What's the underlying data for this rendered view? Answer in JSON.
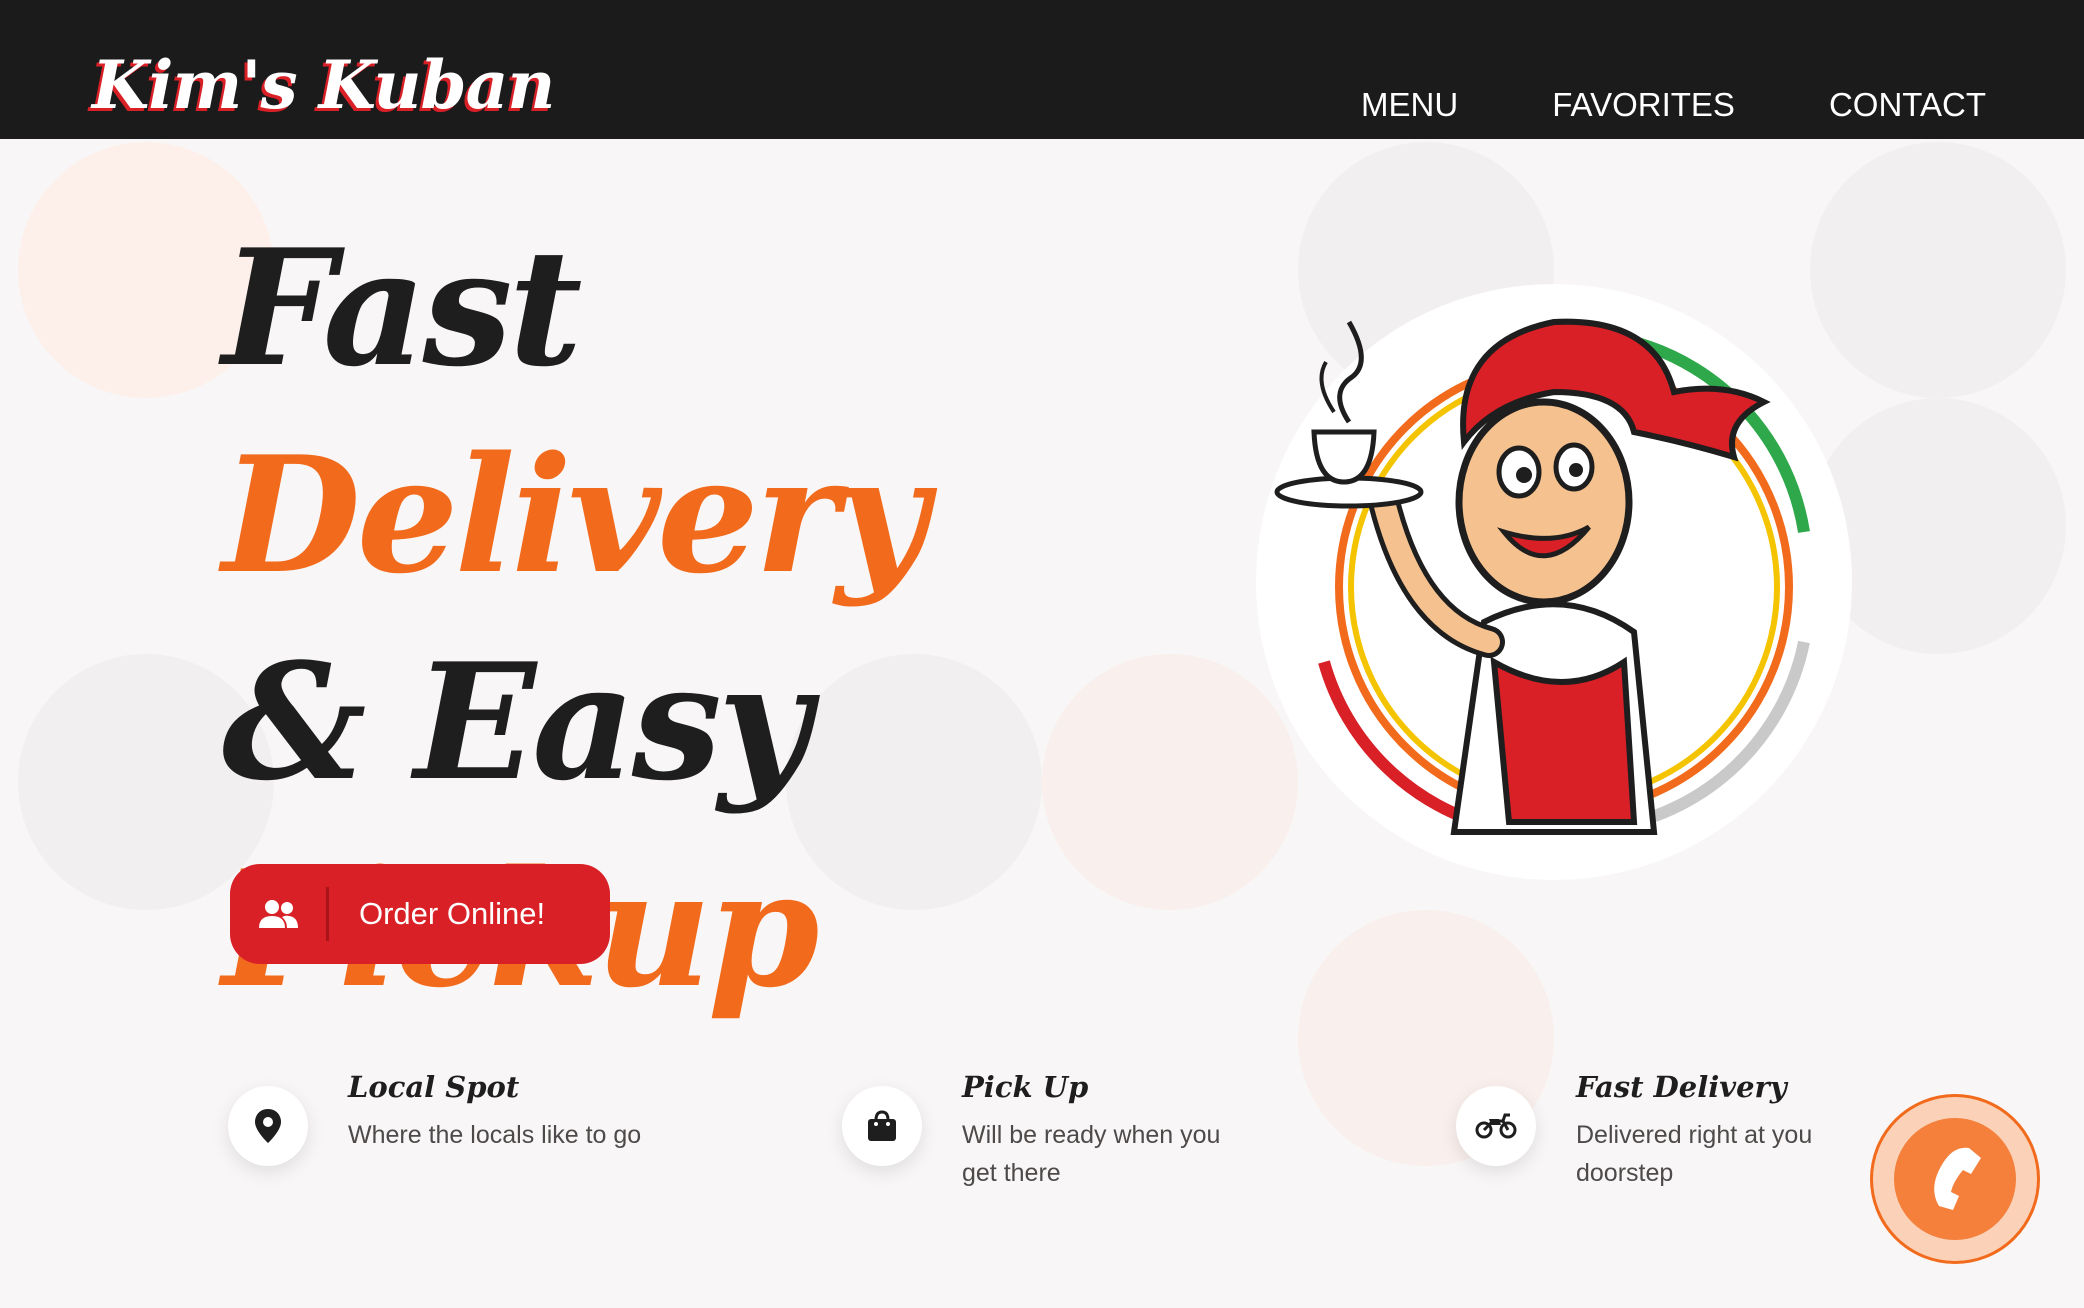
{
  "header": {
    "brand": "Kim's Kuban",
    "nav": [
      "MENU",
      "FAVORITES",
      "CONTACT"
    ]
  },
  "hero": {
    "line1_black": "Fast",
    "line1_orange": "Delivery",
    "line2": "& Easy",
    "line3": "Pickup",
    "cta_label": "Order Online!"
  },
  "features": [
    {
      "title": "Local Spot",
      "text": "Where the locals like to go",
      "icon": "map-pin-icon"
    },
    {
      "title": "Pick Up",
      "text": "Will be ready when you get there",
      "icon": "shopping-bag-icon"
    },
    {
      "title": "Fast Delivery",
      "text": "Delivered right at you doorstep",
      "icon": "motorcycle-icon"
    }
  ],
  "colors": {
    "header_bg": "#1b1b1b",
    "accent_orange": "#f26a1b",
    "accent_red": "#d92027",
    "page_bg": "#f8f6f6"
  }
}
